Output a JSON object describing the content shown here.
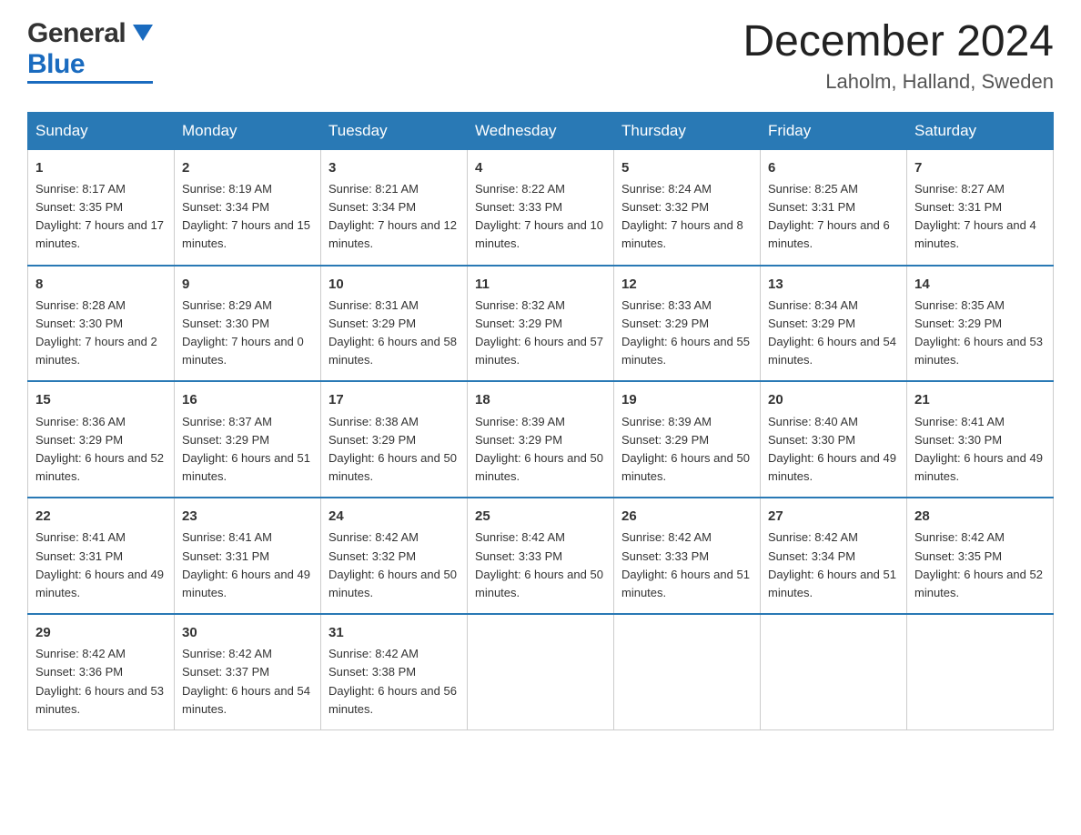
{
  "header": {
    "logo_general": "General",
    "logo_blue": "Blue",
    "month_title": "December 2024",
    "location": "Laholm, Halland, Sweden"
  },
  "days_of_week": [
    "Sunday",
    "Monday",
    "Tuesday",
    "Wednesday",
    "Thursday",
    "Friday",
    "Saturday"
  ],
  "weeks": [
    [
      {
        "day": "1",
        "sunrise": "Sunrise: 8:17 AM",
        "sunset": "Sunset: 3:35 PM",
        "daylight": "Daylight: 7 hours and 17 minutes."
      },
      {
        "day": "2",
        "sunrise": "Sunrise: 8:19 AM",
        "sunset": "Sunset: 3:34 PM",
        "daylight": "Daylight: 7 hours and 15 minutes."
      },
      {
        "day": "3",
        "sunrise": "Sunrise: 8:21 AM",
        "sunset": "Sunset: 3:34 PM",
        "daylight": "Daylight: 7 hours and 12 minutes."
      },
      {
        "day": "4",
        "sunrise": "Sunrise: 8:22 AM",
        "sunset": "Sunset: 3:33 PM",
        "daylight": "Daylight: 7 hours and 10 minutes."
      },
      {
        "day": "5",
        "sunrise": "Sunrise: 8:24 AM",
        "sunset": "Sunset: 3:32 PM",
        "daylight": "Daylight: 7 hours and 8 minutes."
      },
      {
        "day": "6",
        "sunrise": "Sunrise: 8:25 AM",
        "sunset": "Sunset: 3:31 PM",
        "daylight": "Daylight: 7 hours and 6 minutes."
      },
      {
        "day": "7",
        "sunrise": "Sunrise: 8:27 AM",
        "sunset": "Sunset: 3:31 PM",
        "daylight": "Daylight: 7 hours and 4 minutes."
      }
    ],
    [
      {
        "day": "8",
        "sunrise": "Sunrise: 8:28 AM",
        "sunset": "Sunset: 3:30 PM",
        "daylight": "Daylight: 7 hours and 2 minutes."
      },
      {
        "day": "9",
        "sunrise": "Sunrise: 8:29 AM",
        "sunset": "Sunset: 3:30 PM",
        "daylight": "Daylight: 7 hours and 0 minutes."
      },
      {
        "day": "10",
        "sunrise": "Sunrise: 8:31 AM",
        "sunset": "Sunset: 3:29 PM",
        "daylight": "Daylight: 6 hours and 58 minutes."
      },
      {
        "day": "11",
        "sunrise": "Sunrise: 8:32 AM",
        "sunset": "Sunset: 3:29 PM",
        "daylight": "Daylight: 6 hours and 57 minutes."
      },
      {
        "day": "12",
        "sunrise": "Sunrise: 8:33 AM",
        "sunset": "Sunset: 3:29 PM",
        "daylight": "Daylight: 6 hours and 55 minutes."
      },
      {
        "day": "13",
        "sunrise": "Sunrise: 8:34 AM",
        "sunset": "Sunset: 3:29 PM",
        "daylight": "Daylight: 6 hours and 54 minutes."
      },
      {
        "day": "14",
        "sunrise": "Sunrise: 8:35 AM",
        "sunset": "Sunset: 3:29 PM",
        "daylight": "Daylight: 6 hours and 53 minutes."
      }
    ],
    [
      {
        "day": "15",
        "sunrise": "Sunrise: 8:36 AM",
        "sunset": "Sunset: 3:29 PM",
        "daylight": "Daylight: 6 hours and 52 minutes."
      },
      {
        "day": "16",
        "sunrise": "Sunrise: 8:37 AM",
        "sunset": "Sunset: 3:29 PM",
        "daylight": "Daylight: 6 hours and 51 minutes."
      },
      {
        "day": "17",
        "sunrise": "Sunrise: 8:38 AM",
        "sunset": "Sunset: 3:29 PM",
        "daylight": "Daylight: 6 hours and 50 minutes."
      },
      {
        "day": "18",
        "sunrise": "Sunrise: 8:39 AM",
        "sunset": "Sunset: 3:29 PM",
        "daylight": "Daylight: 6 hours and 50 minutes."
      },
      {
        "day": "19",
        "sunrise": "Sunrise: 8:39 AM",
        "sunset": "Sunset: 3:29 PM",
        "daylight": "Daylight: 6 hours and 50 minutes."
      },
      {
        "day": "20",
        "sunrise": "Sunrise: 8:40 AM",
        "sunset": "Sunset: 3:30 PM",
        "daylight": "Daylight: 6 hours and 49 minutes."
      },
      {
        "day": "21",
        "sunrise": "Sunrise: 8:41 AM",
        "sunset": "Sunset: 3:30 PM",
        "daylight": "Daylight: 6 hours and 49 minutes."
      }
    ],
    [
      {
        "day": "22",
        "sunrise": "Sunrise: 8:41 AM",
        "sunset": "Sunset: 3:31 PM",
        "daylight": "Daylight: 6 hours and 49 minutes."
      },
      {
        "day": "23",
        "sunrise": "Sunrise: 8:41 AM",
        "sunset": "Sunset: 3:31 PM",
        "daylight": "Daylight: 6 hours and 49 minutes."
      },
      {
        "day": "24",
        "sunrise": "Sunrise: 8:42 AM",
        "sunset": "Sunset: 3:32 PM",
        "daylight": "Daylight: 6 hours and 50 minutes."
      },
      {
        "day": "25",
        "sunrise": "Sunrise: 8:42 AM",
        "sunset": "Sunset: 3:33 PM",
        "daylight": "Daylight: 6 hours and 50 minutes."
      },
      {
        "day": "26",
        "sunrise": "Sunrise: 8:42 AM",
        "sunset": "Sunset: 3:33 PM",
        "daylight": "Daylight: 6 hours and 51 minutes."
      },
      {
        "day": "27",
        "sunrise": "Sunrise: 8:42 AM",
        "sunset": "Sunset: 3:34 PM",
        "daylight": "Daylight: 6 hours and 51 minutes."
      },
      {
        "day": "28",
        "sunrise": "Sunrise: 8:42 AM",
        "sunset": "Sunset: 3:35 PM",
        "daylight": "Daylight: 6 hours and 52 minutes."
      }
    ],
    [
      {
        "day": "29",
        "sunrise": "Sunrise: 8:42 AM",
        "sunset": "Sunset: 3:36 PM",
        "daylight": "Daylight: 6 hours and 53 minutes."
      },
      {
        "day": "30",
        "sunrise": "Sunrise: 8:42 AM",
        "sunset": "Sunset: 3:37 PM",
        "daylight": "Daylight: 6 hours and 54 minutes."
      },
      {
        "day": "31",
        "sunrise": "Sunrise: 8:42 AM",
        "sunset": "Sunset: 3:38 PM",
        "daylight": "Daylight: 6 hours and 56 minutes."
      },
      {
        "day": "",
        "sunrise": "",
        "sunset": "",
        "daylight": ""
      },
      {
        "day": "",
        "sunrise": "",
        "sunset": "",
        "daylight": ""
      },
      {
        "day": "",
        "sunrise": "",
        "sunset": "",
        "daylight": ""
      },
      {
        "day": "",
        "sunrise": "",
        "sunset": "",
        "daylight": ""
      }
    ]
  ]
}
